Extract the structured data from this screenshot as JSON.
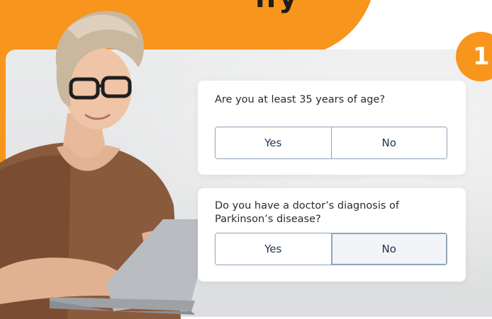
{
  "header": {
    "headline_fragment": "ify"
  },
  "step_badge": {
    "number": "1"
  },
  "questions": [
    {
      "text": "Are you at least 35 years of age?",
      "options": [
        "Yes",
        "No"
      ],
      "selected": null
    },
    {
      "text_line1": "Do you have a doctor’s diagnosis of",
      "text_line2": "Parkinson’s disease?",
      "options": [
        "Yes",
        "No"
      ],
      "selected": "No"
    }
  ],
  "colors": {
    "accent_orange": "#f7951d",
    "button_border": "#8fa4b8",
    "button_text": "#1f3350",
    "panel_bg": "#e6e7e8"
  },
  "icons": {
    "illustration": "woman-with-laptop"
  }
}
